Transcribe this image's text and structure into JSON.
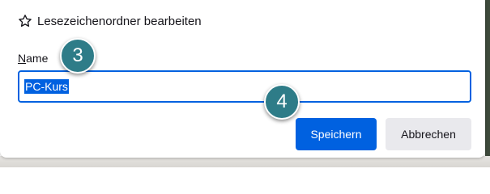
{
  "dialog": {
    "title": "Lesezeichenordner bearbeiten",
    "title_icon": "star-icon"
  },
  "name_field": {
    "label_accesskey": "N",
    "label_rest": "ame",
    "value": "PC-Kurs"
  },
  "buttons": {
    "save_label": "Speichern",
    "cancel_label": "Abbrechen"
  },
  "annotations": {
    "step_3": "3",
    "step_4": "4"
  },
  "colors": {
    "accent": "#0061e0",
    "badge": "#2e7c88",
    "cancel_bg": "#e9e9ed"
  }
}
